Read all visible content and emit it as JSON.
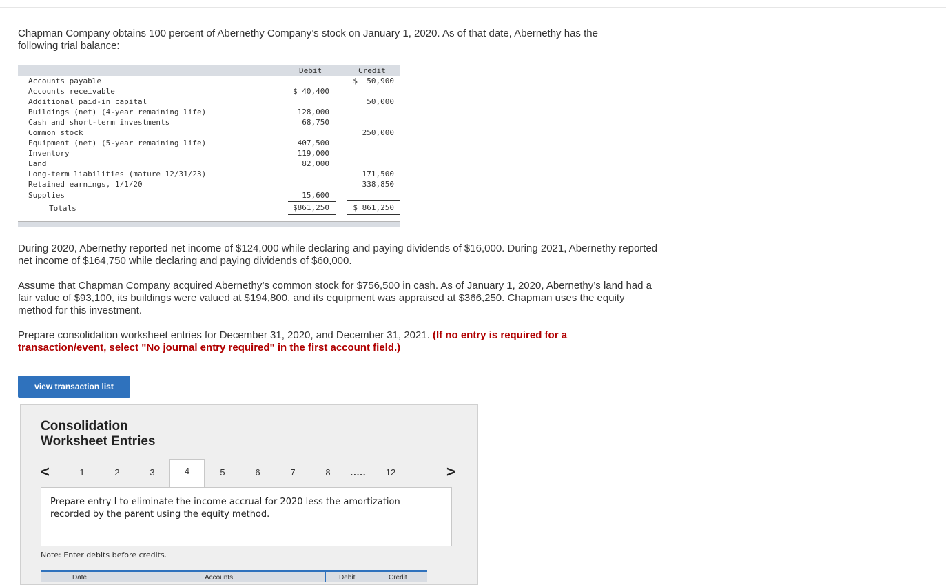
{
  "intro": "Chapman Company obtains 100 percent of Abernethy Company’s stock on January 1, 2020. As of that date, Abernethy has the following trial balance:",
  "trial_balance": {
    "header_debit": "Debit",
    "header_credit": "Credit",
    "rows": [
      {
        "label": "Accounts payable",
        "debit": "",
        "credit": "$  50,900"
      },
      {
        "label": "Accounts receivable",
        "debit": "$ 40,400",
        "credit": ""
      },
      {
        "label": "Additional paid-in capital",
        "debit": "",
        "credit": "50,000"
      },
      {
        "label": "Buildings (net) (4-year remaining life)",
        "debit": "128,000",
        "credit": ""
      },
      {
        "label": "Cash and short-term investments",
        "debit": "68,750",
        "credit": ""
      },
      {
        "label": "Common stock",
        "debit": "",
        "credit": "250,000"
      },
      {
        "label": "Equipment (net) (5-year remaining life)",
        "debit": "407,500",
        "credit": ""
      },
      {
        "label": "Inventory",
        "debit": "119,000",
        "credit": ""
      },
      {
        "label": "Land",
        "debit": "82,000",
        "credit": ""
      },
      {
        "label": "Long-term liabilities (mature 12/31/23)",
        "debit": "",
        "credit": "171,500"
      },
      {
        "label": "Retained earnings, 1/1/20",
        "debit": "",
        "credit": "338,850"
      },
      {
        "label": "Supplies",
        "debit": "15,600",
        "credit": ""
      }
    ],
    "totals_label": "Totals",
    "total_debit": "$861,250",
    "total_credit": "$ 861,250"
  },
  "para2": "During 2020, Abernethy reported net income of $124,000 while declaring and paying dividends of $16,000. During 2021, Abernethy reported net income of $164,750 while declaring and paying dividends of $60,000.",
  "para3": "Assume that Chapman Company acquired Abernethy’s common stock for $756,500 in cash. As of January 1, 2020, Abernethy’s land had a fair value of $93,100, its buildings were valued at $194,800, and its equipment was appraised at $366,250. Chapman uses the equity method for this investment.",
  "para4_normal": "Prepare consolidation worksheet entries for December 31, 2020, and December 31, 2021. ",
  "para4_warn": "(If no entry is required for a transaction/event, select \"No journal entry required\" in the first account field.)",
  "view_button": "view transaction list",
  "panel": {
    "title_line1": "Consolidation",
    "title_line2": "Worksheet Entries",
    "pages": [
      "1",
      "2",
      "3",
      "4",
      "5",
      "6",
      "7",
      "8"
    ],
    "active_page": "4",
    "ellipsis": ".....",
    "last_page": "12",
    "prev_glyph": "<",
    "next_glyph": ">",
    "instruction": "Prepare entry I to eliminate the income accrual for 2020 less the amortization recorded by the parent using the equity method.",
    "note": "Note: Enter debits before credits.",
    "journal_headers": [
      "Date",
      "Accounts",
      "Debit",
      "Credit"
    ]
  }
}
